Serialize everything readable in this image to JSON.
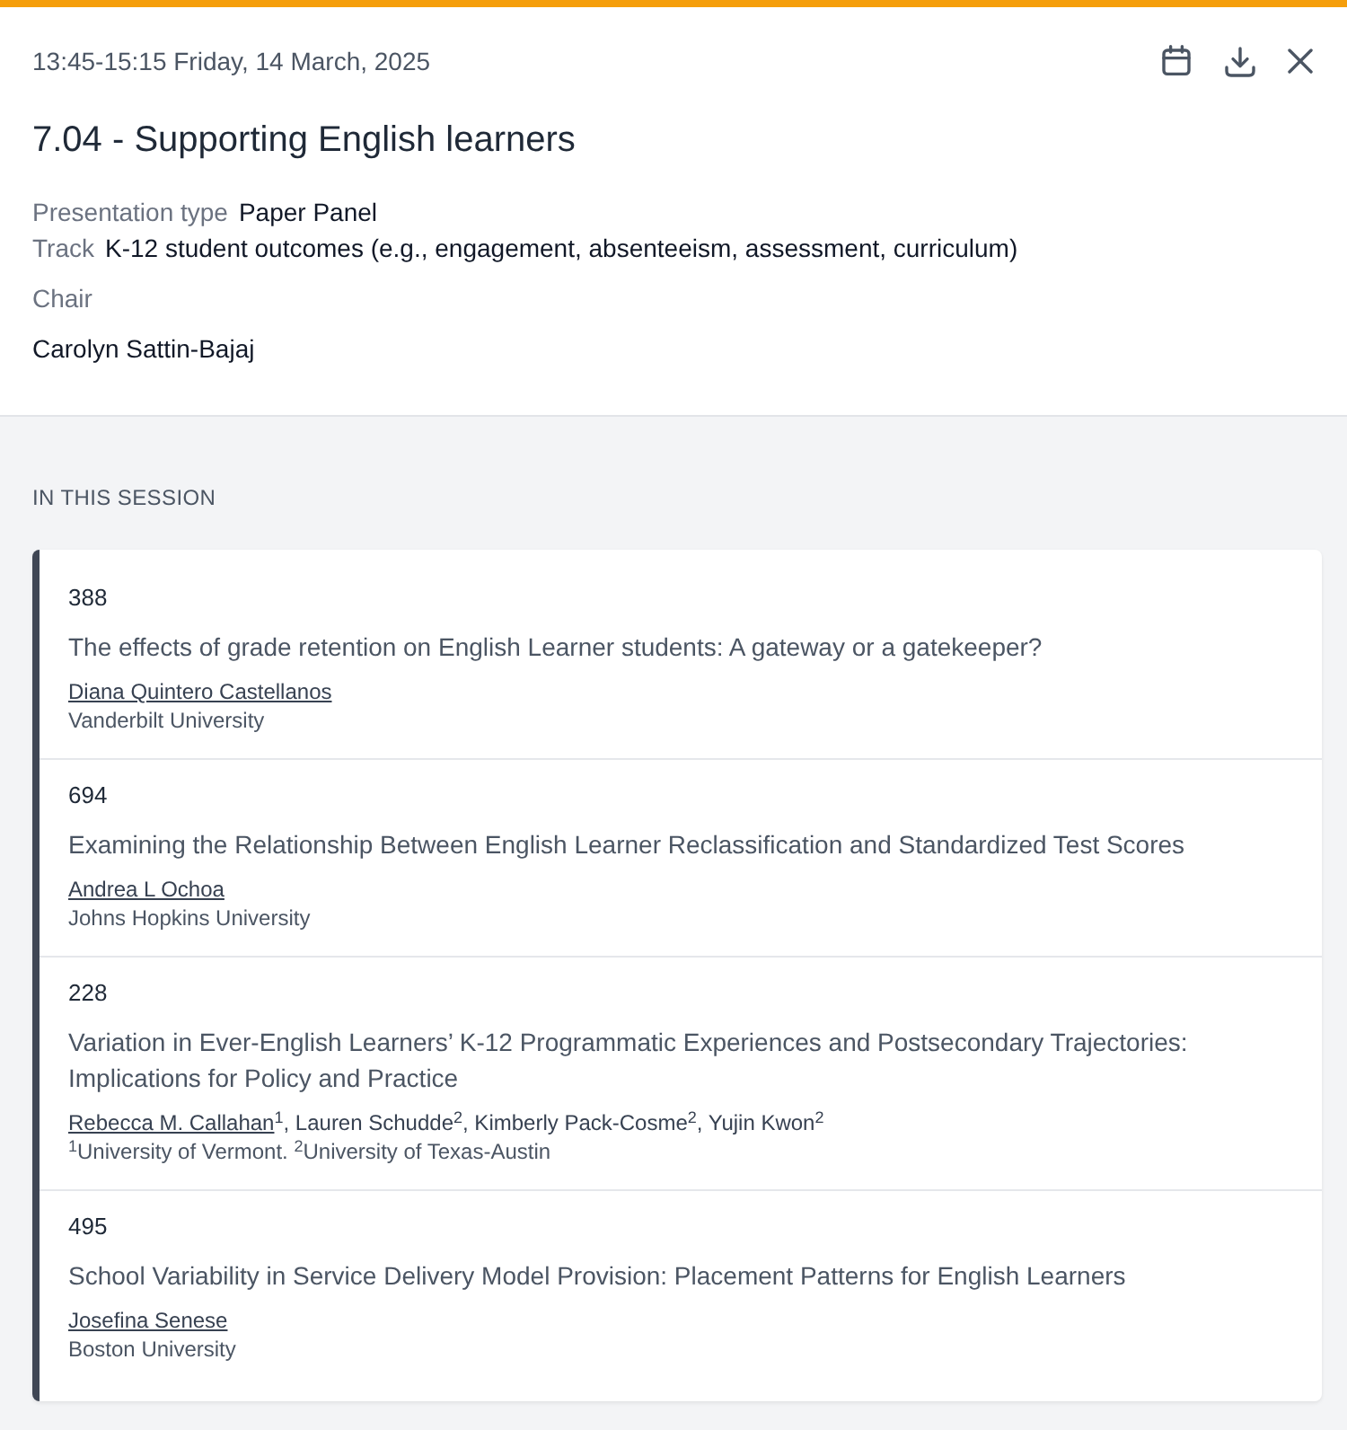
{
  "session": {
    "time": "13:45-15:15 Friday, 14 March, 2025",
    "title": "7.04 - Supporting English learners",
    "details": [
      {
        "label": "Presentation type",
        "value": "Paper Panel"
      },
      {
        "label": "Track",
        "value": "K-12 student outcomes (e.g., engagement, absenteeism, assessment, curriculum)"
      }
    ],
    "chair": {
      "label": "Chair",
      "name": "Carolyn Sattin-Bajaj"
    }
  },
  "in_this_session": {
    "heading": "IN THIS SESSION",
    "papers": [
      {
        "number": "388",
        "title": "The effects of grade retention on English Learner students: A gateway or a gatekeeper?",
        "authors": [
          {
            "text": "Diana Quintero Castellanos",
            "linked": true
          }
        ],
        "affiliation": "Vanderbilt University"
      },
      {
        "number": "694",
        "title": "Examining the Relationship Between English Learner Reclassification and Standardized Test Scores",
        "authors": [
          {
            "text": "Andrea L Ochoa",
            "linked": true
          }
        ],
        "affiliation": "Johns Hopkins University"
      },
      {
        "number": "228",
        "title": "Variation in Ever-English Learners’ K-12 Programmatic Experiences and Postsecondary Trajectories: Implications for Policy and Practice",
        "authors": [
          {
            "text": "Rebecca M. Callahan",
            "linked": true
          },
          {
            "text": "$^{1}$, Lauren Schudde$^{2}$, Kimberly Pack-Cosme$^{2}$, Yujin Kwon$^{2}$",
            "linked": false
          }
        ],
        "affiliation": "$^{1}$University of Vermont. $^{2}$University of Texas-Austin"
      },
      {
        "number": "495",
        "title": "School Variability in Service Delivery Model Provision: Placement Patterns for English Learners",
        "authors": [
          {
            "text": "Josefina Senese",
            "linked": true
          }
        ],
        "affiliation": "Boston University"
      }
    ]
  }
}
